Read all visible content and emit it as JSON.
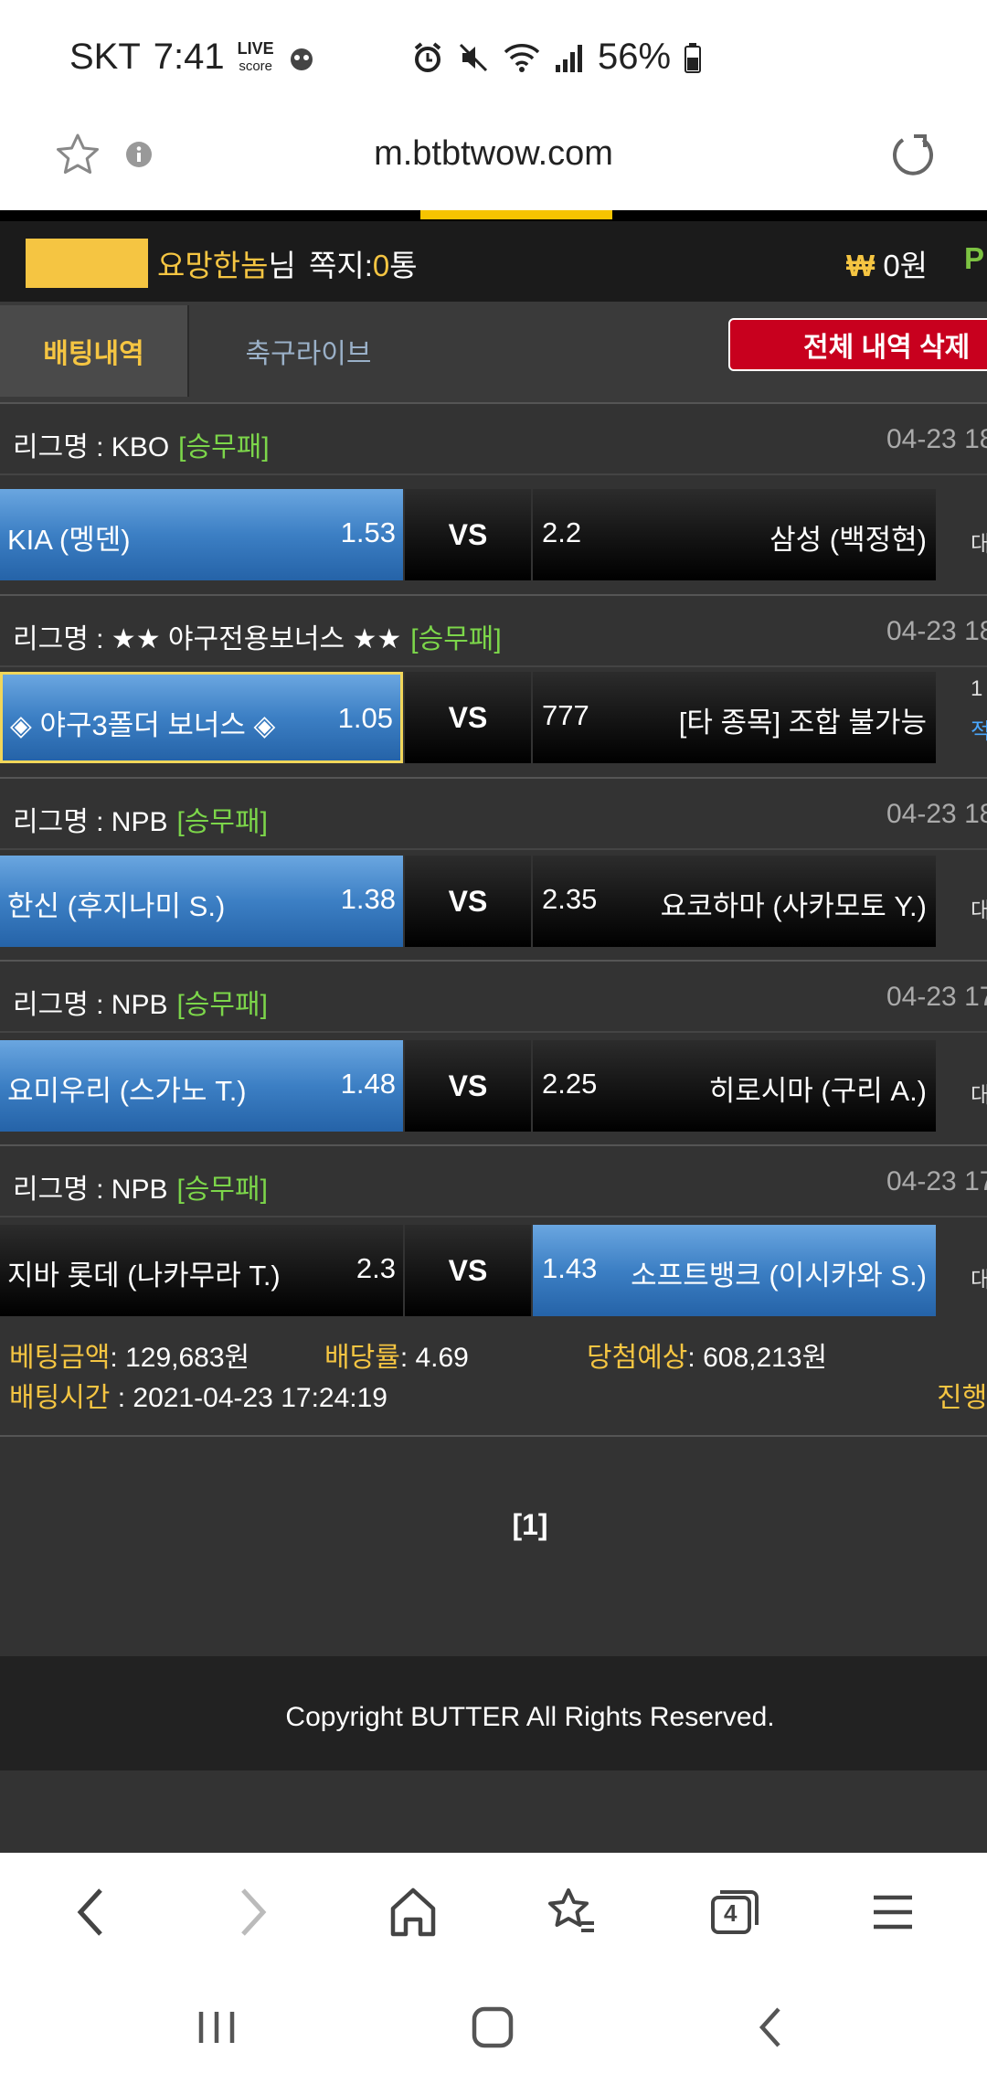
{
  "status_bar": {
    "carrier": "SKT",
    "time": "7:41",
    "live_badge_top": "LIVE",
    "live_badge_bottom": "score",
    "battery": "56%"
  },
  "browser": {
    "url": "m.btbtwow.com",
    "tab_count": "4"
  },
  "user": {
    "nickname": "요망한놈",
    "suffix": "님",
    "message_label": "쪽지:",
    "message_count": "0",
    "message_unit": "통",
    "won_symbol": "₩",
    "balance": "0원",
    "points_label": "P"
  },
  "tabs": {
    "betting_history": "배팅내역",
    "soccer_live": "축구라이브",
    "delete_all": "전체 내역 삭제"
  },
  "bets": [
    {
      "league": "리그명 : KBO",
      "tag": "[승무패]",
      "date": "04-23 18",
      "home": "KIA (멩덴)",
      "home_odds": "1.53",
      "vs": "VS",
      "away_odds": "2.2",
      "away": "삼성 (백정현)",
      "result": "대"
    },
    {
      "league": "리그명 : ★★ 야구전용보너스 ★★",
      "tag": "[승무패]",
      "date": "04-23 18",
      "home": "◈ 야구3폴더 보너스 ◈",
      "home_odds": "1.05",
      "vs": "VS",
      "away_odds": "777",
      "away": "[타 종목] 조합 불가능",
      "result_top": "1",
      "result": "적"
    },
    {
      "league": "리그명 : NPB",
      "tag": "[승무패]",
      "date": "04-23 18",
      "home": "한신 (후지나미 S.)",
      "home_odds": "1.38",
      "vs": "VS",
      "away_odds": "2.35",
      "away": "요코하마 (사카모토 Y.)",
      "result": "대"
    },
    {
      "league": "리그명 : NPB",
      "tag": "[승무패]",
      "date": "04-23 17",
      "home": "요미우리 (스가노 T.)",
      "home_odds": "1.48",
      "vs": "VS",
      "away_odds": "2.25",
      "away": "히로시마 (구리 A.)",
      "result": "대"
    },
    {
      "league": "리그명 : NPB",
      "tag": "[승무패]",
      "date": "04-23 17",
      "home": "지바 롯데 (나카무라 T.)",
      "home_odds": "2.3",
      "vs": "VS",
      "away_odds": "1.43",
      "away": "소프트뱅크 (이시카와 S.)",
      "result": "대"
    }
  ],
  "summary": {
    "amount_label": "베팅금액",
    "amount_value": ": 129,683원",
    "rate_label": "배당률",
    "rate_value": ": 4.69",
    "win_label": "당첨예상",
    "win_value": ": 608,213원",
    "time_label": "배팅시간",
    "time_value": " : 2021-04-23 17:24:19",
    "status": "진행"
  },
  "pagination": "[1]",
  "footer": "Copyright BUTTER All Rights Reserved.",
  "colors": {
    "accent_yellow": "#f5c542",
    "tag_green": "#7cd64a",
    "delete_red": "#c8001e",
    "selected_blue": "#3c7fc4"
  }
}
